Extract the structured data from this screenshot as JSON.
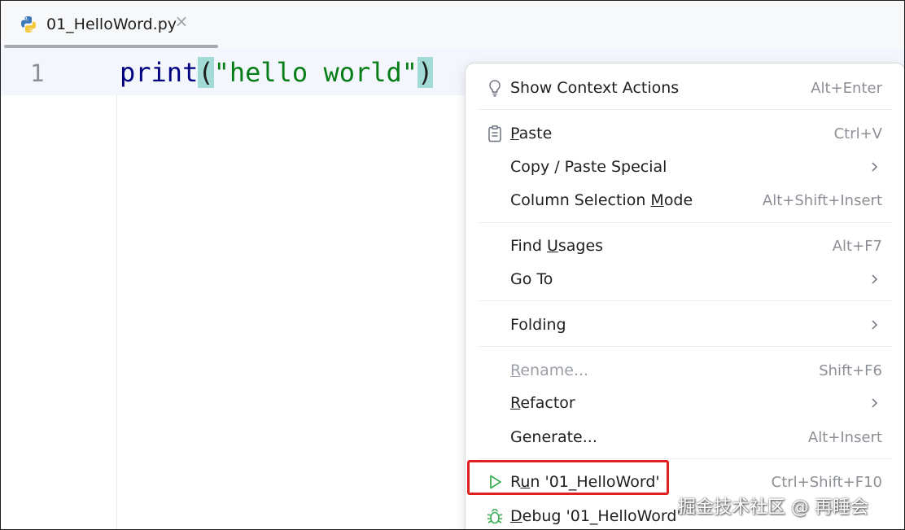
{
  "tab": {
    "file_name": "01_HelloWord.py",
    "close_symbol": "×",
    "icon": "python-icon"
  },
  "editor": {
    "line_number": "1",
    "code": {
      "keyword": "print",
      "open_paren": "(",
      "string": "\"hello world\"",
      "close_paren": ")"
    }
  },
  "context_menu": {
    "items": [
      {
        "label": "Show Context Actions",
        "shortcut": "Alt+Enter",
        "icon": "lightbulb-icon"
      },
      {
        "label_before": "",
        "mnemonic": "P",
        "label_after": "aste",
        "shortcut": "Ctrl+V",
        "icon": "clipboard-icon"
      },
      {
        "label": "Copy / Paste Special",
        "has_submenu": true
      },
      {
        "label_before": "Column Selection ",
        "mnemonic": "M",
        "label_after": "ode",
        "shortcut": "Alt+Shift+Insert"
      },
      {
        "label_before": "Find ",
        "mnemonic": "U",
        "label_after": "sages",
        "shortcut": "Alt+F7"
      },
      {
        "label": "Go To",
        "has_submenu": true
      },
      {
        "label": "Folding",
        "has_submenu": true
      },
      {
        "label_before": "",
        "mnemonic": "R",
        "label_after": "ename...",
        "shortcut": "Shift+F6",
        "disabled": true
      },
      {
        "label_before": "",
        "mnemonic": "R",
        "label_after": "efactor",
        "has_submenu": true
      },
      {
        "label": "Generate...",
        "shortcut": "Alt+Insert"
      },
      {
        "label_before": "R",
        "mnemonic": "u",
        "label_after": "n '01_HelloWord'",
        "shortcut": "Ctrl+Shift+F10",
        "icon": "run-play-icon"
      },
      {
        "label_before": "",
        "mnemonic": "D",
        "label_after": "ebug '01_HelloWord'",
        "icon": "debug-bug-icon"
      }
    ]
  },
  "watermark": "掘金技术社区 @ 再睡会",
  "colors": {
    "keyword": "#000080",
    "string": "#067d17",
    "paren_match": "#a2dbd5",
    "run_icon": "#3fae5a",
    "highlight_box": "#e02020",
    "disabled_text": "#9a9ea6"
  }
}
